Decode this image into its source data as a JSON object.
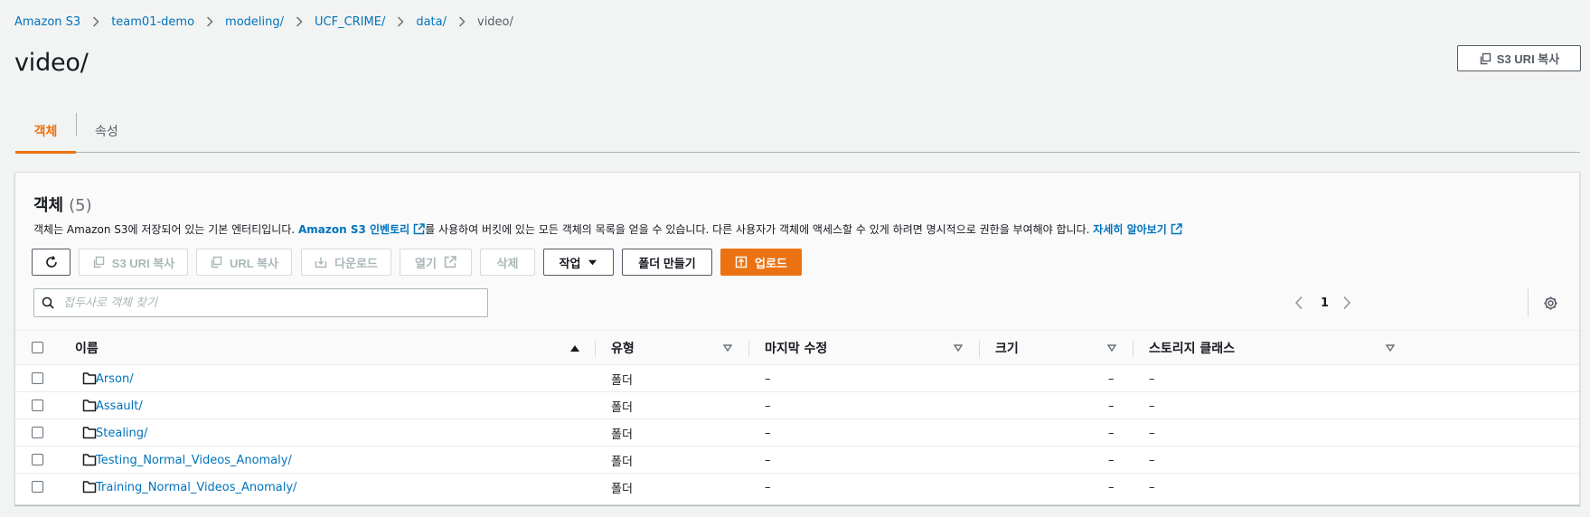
{
  "breadcrumb": {
    "items": [
      "Amazon S3",
      "team01-demo",
      "modeling/",
      "UCF_CRIME/",
      "data/"
    ],
    "current": "video/"
  },
  "page": {
    "title": "video/",
    "copy_uri_label": "S3 URI 복사"
  },
  "tabs": [
    "객체",
    "속성"
  ],
  "panel": {
    "title": "객체",
    "count": "(5)",
    "desc_prefix": "객체는 Amazon S3에 저장되어 있는 기본 엔터티입니다. ",
    "desc_link1": "Amazon S3 인벤토리",
    "desc_middle": "를 사용하여 버킷에 있는 모든 객체의 목록을 얻을 수 있습니다. 다른 사용자가 객체에 액세스할 수 있게 하려면 명시적으로 권한을 부여해야 합니다. ",
    "desc_link2": "자세히 알아보기"
  },
  "toolbar": {
    "copy_s3_uri": "S3 URI 복사",
    "copy_url": "URL 복사",
    "download": "다운로드",
    "open": "열기",
    "delete": "삭제",
    "actions": "작업",
    "create_folder": "폴더 만들기",
    "upload": "업로드"
  },
  "search": {
    "placeholder": "접두사로 객체 찾기"
  },
  "pagination": {
    "page": "1"
  },
  "table": {
    "columns": [
      "이름",
      "유형",
      "마지막 수정",
      "크기",
      "스토리지 클래스"
    ],
    "rows": [
      {
        "name": "Arson/",
        "type": "폴더",
        "modified": "–",
        "size": "–",
        "class": "–"
      },
      {
        "name": "Assault/",
        "type": "폴더",
        "modified": "–",
        "size": "–",
        "class": "–"
      },
      {
        "name": "Stealing/",
        "type": "폴더",
        "modified": "–",
        "size": "–",
        "class": "–"
      },
      {
        "name": "Testing_Normal_Videos_Anomaly/",
        "type": "폴더",
        "modified": "–",
        "size": "–",
        "class": "–"
      },
      {
        "name": "Training_Normal_Videos_Anomaly/",
        "type": "폴더",
        "modified": "–",
        "size": "–",
        "class": "–"
      }
    ]
  },
  "colors": {
    "link": "#0073bb",
    "accent": "#ec7211",
    "text": "#16191f",
    "muted": "#545b64",
    "background": "#f2f3f3"
  },
  "icons": [
    "chevron-right-icon",
    "copy-icon",
    "external-link-icon",
    "refresh-icon",
    "download-icon",
    "caret-down-icon",
    "upload-icon",
    "search-icon",
    "chevron-left-icon",
    "gear-icon",
    "sort-asc-icon",
    "sort-icon",
    "folder-icon"
  ]
}
